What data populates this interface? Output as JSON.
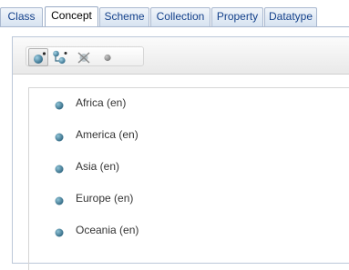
{
  "tabs": [
    {
      "label": "Class",
      "active": false
    },
    {
      "label": "Concept",
      "active": true
    },
    {
      "label": "Scheme",
      "active": false
    },
    {
      "label": "Collection",
      "active": false
    },
    {
      "label": "Property",
      "active": false
    },
    {
      "label": "Datatype",
      "active": false
    }
  ],
  "toolbar": {
    "buttons": [
      {
        "icon": "concept-list-icon",
        "active": true
      },
      {
        "icon": "concept-tree-icon",
        "active": false
      },
      {
        "icon": "concept-delete-icon",
        "active": false
      },
      {
        "icon": "concept-disabled-icon",
        "active": false
      }
    ]
  },
  "concepts": [
    {
      "label": "Africa (en)",
      "icon": "concept-instance-icon"
    },
    {
      "label": "America (en)",
      "icon": "concept-instance-icon"
    },
    {
      "label": "Asia (en)",
      "icon": "concept-instance-icon"
    },
    {
      "label": "Europe (en)",
      "icon": "concept-instance-icon"
    },
    {
      "label": "Oceania (en)",
      "icon": "concept-instance-icon"
    }
  ],
  "colors": {
    "bullet": "#3f7a94",
    "tab_text": "#15428b"
  }
}
